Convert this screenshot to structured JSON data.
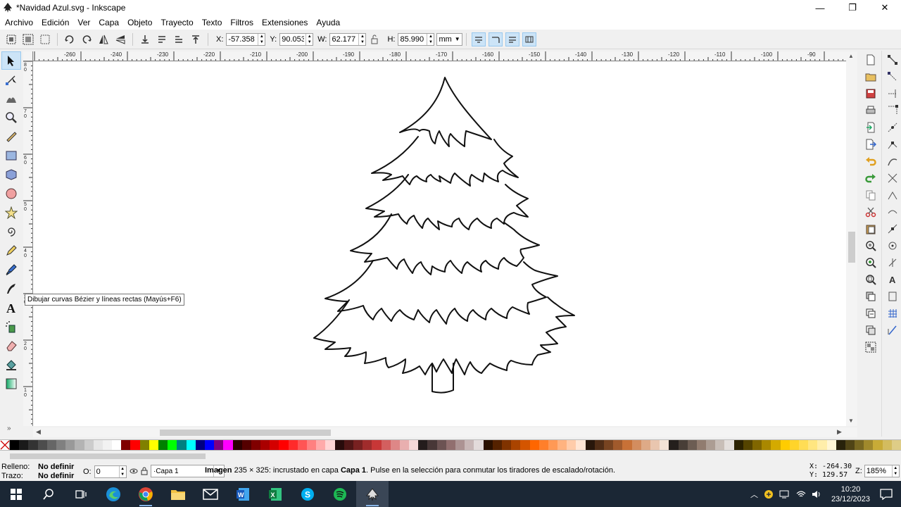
{
  "window": {
    "title": "*Navidad Azul.svg - Inkscape",
    "minimize": "—",
    "maximize": "❐",
    "close": "✕"
  },
  "menu": [
    "Archivo",
    "Edición",
    "Ver",
    "Capa",
    "Objeto",
    "Trayecto",
    "Texto",
    "Filtros",
    "Extensiones",
    "Ayuda"
  ],
  "controls": {
    "x_label": "X:",
    "x_value": "-57.358",
    "y_label": "Y:",
    "y_value": "90.053",
    "w_label": "W:",
    "w_value": "62.177",
    "h_label": "H:",
    "h_value": "85.990",
    "unit": "mm"
  },
  "rulers": {
    "horizontal": [
      "-260",
      "-240",
      "-230",
      "-220",
      "-210",
      "-200",
      "-190",
      "-180",
      "-170",
      "-160",
      "-150",
      "-140",
      "-130",
      "-120",
      "-110",
      "-100",
      "-90"
    ],
    "vertical": [
      "80",
      "70",
      "60",
      "50",
      "40",
      "30",
      "20",
      "10"
    ]
  },
  "tooltip": "Dibujar curvas Bézier y líneas rectas (Mayús+F6)",
  "palette": [
    "#000000",
    "#1a1a1a",
    "#333333",
    "#4d4d4d",
    "#666666",
    "#808080",
    "#999999",
    "#b3b3b3",
    "#cccccc",
    "#e6e6e6",
    "#f2f2f2",
    "#ffffff",
    "#800000",
    "#ff0000",
    "#808000",
    "#ffff00",
    "#008000",
    "#00ff00",
    "#008080",
    "#00ffff",
    "#000080",
    "#0000ff",
    "#800080",
    "#ff00ff",
    "#2b0000",
    "#550000",
    "#800000",
    "#aa0000",
    "#d40000",
    "#ff0000",
    "#ff2a2a",
    "#ff5555",
    "#ff8080",
    "#ffaaaa",
    "#ffd5d5",
    "#280b0b",
    "#501616",
    "#782121",
    "#a02c2c",
    "#c83737",
    "#d35f5f",
    "#de8787",
    "#e9afaf",
    "#f4d7d7",
    "#241c1c",
    "#483737",
    "#6c5353",
    "#916f6f",
    "#ac9393",
    "#c8b7b7",
    "#e3dbdb",
    "#2b1100",
    "#552200",
    "#803300",
    "#aa4400",
    "#d45500",
    "#ff6600",
    "#ff7f2a",
    "#ff9955",
    "#ffb380",
    "#ffccaa",
    "#ffe6d5",
    "#28170b",
    "#502d16",
    "#784421",
    "#a05a2c",
    "#c87137",
    "#d38d5f",
    "#deaa87",
    "#e9c6af",
    "#f4e3d7",
    "#241f1c",
    "#483e37",
    "#6c5d53",
    "#917c6f",
    "#ac9d93",
    "#c8beb7",
    "#e3dedb",
    "#2b2200",
    "#554400",
    "#806600",
    "#aa8800",
    "#d4aa00",
    "#ffcc00",
    "#ffd42a",
    "#ffdd55",
    "#ffe680",
    "#ffeeaa",
    "#fff6d5",
    "#28220b",
    "#504416",
    "#786721",
    "#a0892c",
    "#c8ab37",
    "#d3bc5f",
    "#decd87"
  ],
  "status": {
    "fill_label": "Relleno:",
    "fill_value": "No definir",
    "stroke_label": "Trazo:",
    "stroke_value": "No definir",
    "opacity_label": "O:",
    "opacity_value": "0",
    "layer": "·Capa 1",
    "msg_type": "Imagen",
    "msg_part1": " 235 × 325: incrustado en capa ",
    "msg_layer": "Capa 1",
    "msg_part2": ". Pulse en la selección para conmutar los tiradores de escalado/rotación.",
    "coord_x": "X: -264.30",
    "coord_y": "Y:  129.57",
    "zoom_label": "Z:",
    "zoom_value": "185%"
  },
  "taskbar": {
    "time": "10:20",
    "date": "23/12/2023"
  }
}
